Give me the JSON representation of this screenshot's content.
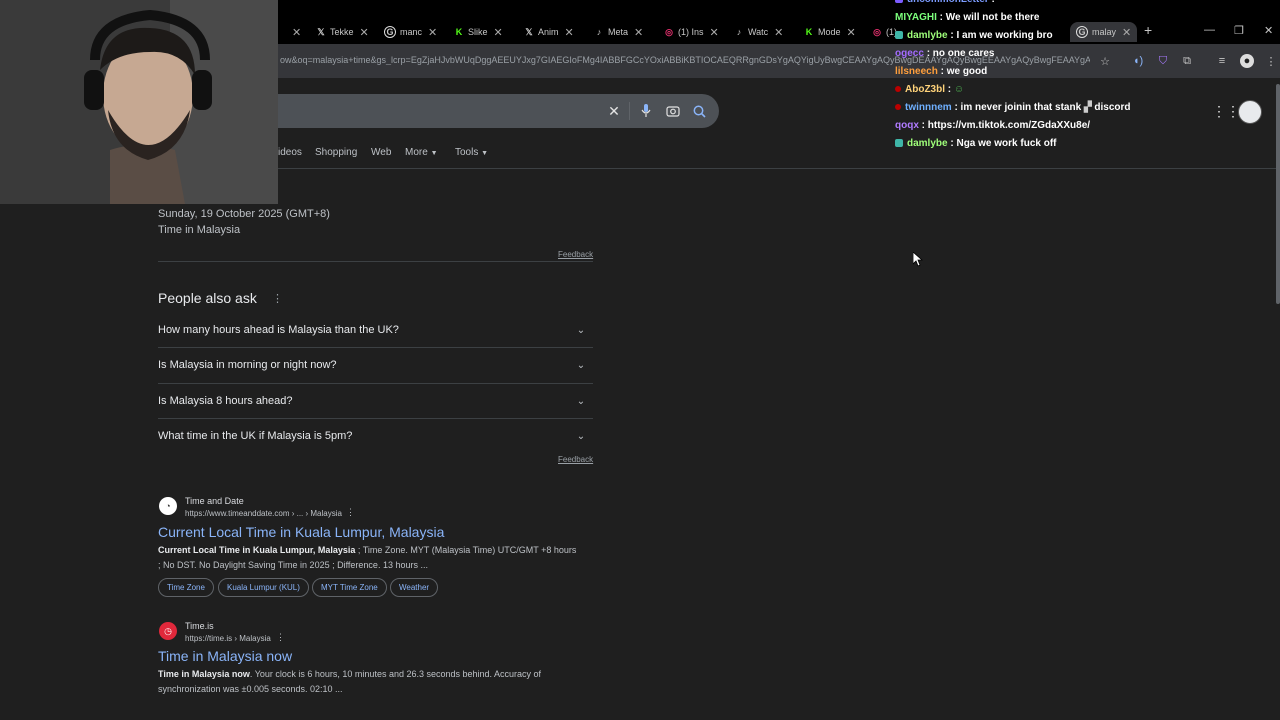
{
  "browser": {
    "tabs": [
      {
        "label": "",
        "icon": "close-icon"
      },
      {
        "label": "Tekke",
        "icon": "x-logo-icon"
      },
      {
        "label": "manc",
        "icon": "google-icon"
      },
      {
        "label": "Slike",
        "icon": "kick-icon"
      },
      {
        "label": "Anim",
        "icon": "x-logo-icon"
      },
      {
        "label": "Meta",
        "icon": "tiktok-icon"
      },
      {
        "label": "(1) Ins",
        "icon": "instagram-icon"
      },
      {
        "label": "Watc",
        "icon": "tiktok-icon"
      },
      {
        "label": "Mode",
        "icon": "kick-icon"
      },
      {
        "label": "(1)",
        "icon": "instagram-icon"
      },
      {
        "label": "malay",
        "icon": "google-icon"
      }
    ],
    "url": "ow&oq=malaysia+time&gs_lcrp=EgZjaHJvbWUqDggAEEUYJxg7GIAEGIoFMg4IABBFGCcYOxiABBiKBTIOCAEQRRgnGDsYgAQYigUyBwgCEAAYgAQyBwgDEAAYgAQyBwgEEAAYgAQyBwgFEAAYgAQyBwgGEAAYgAQyBwgFEAAYgAQyBwgB..."
  },
  "search": {
    "nav": [
      "ideos",
      "Shopping",
      "Web",
      "More",
      "Tools"
    ]
  },
  "time_result": {
    "date": "Sunday, 19 October 2025 (GMT+8)",
    "place": "Time in Malaysia",
    "feedback": "Feedback"
  },
  "paa": {
    "title": "People also ask",
    "questions": [
      "How many hours ahead is Malaysia than the UK?",
      "Is Malaysia in morning or night now?",
      "Is Malaysia 8 hours ahead?",
      "What time in the UK if Malaysia is 5pm?"
    ],
    "feedback": "Feedback"
  },
  "results": [
    {
      "site": "Time and Date",
      "url": "https://www.timeanddate.com › ... › Malaysia",
      "title": "Current Local Time in Kuala Lumpur, Malaysia",
      "snippet_line1_bold": "Current Local Time in Kuala Lumpur, Malaysia",
      "snippet_line1_rest": " ; Time Zone. MYT (Malaysia Time) UTC/GMT +8 hours",
      "snippet_line2": "; No DST. No Daylight Saving Time in 2025 ; Difference. 13 hours ...",
      "chips": [
        "Time Zone",
        "Kuala Lumpur (KUL)",
        "MYT Time Zone",
        "Weather"
      ]
    },
    {
      "site": "Time.is",
      "url": "https://time.is › Malaysia",
      "title": "Time in Malaysia now",
      "snippet_line1_bold": "Time in Malaysia now",
      "snippet_line1_rest": ". Your clock is 6 hours, 10 minutes and 26.3 seconds behind. Accuracy of",
      "snippet_line2": "synchronization was ±0.005 seconds. 02:10 ..."
    }
  ],
  "chat": [
    {
      "user": "uncommonLetter",
      "msg": ":",
      "color": "#7c9cff"
    },
    {
      "user": "MIYAGHI",
      "msg": ": We will not be there",
      "color": "#7cff7c"
    },
    {
      "user": "damlybe",
      "msg": ": I am we working bro",
      "color": "#9fff7a"
    },
    {
      "user": "ogecc",
      "msg": ": no one cares",
      "color": "#a36bff"
    },
    {
      "user": "lilsneech",
      "msg": ": we good",
      "color": "#ff9f3c"
    },
    {
      "user": "AboZ3bl",
      "msg": ":",
      "color": "#ffd37a"
    },
    {
      "user": "twinnnem",
      "msg": ": im never joinin that stank",
      "msg2": "discord",
      "color": "#6fb0ff"
    },
    {
      "user": "qoqx",
      "msg": ": https://vm.tiktok.com/ZGdaXXu8e/",
      "color": "#b07bff"
    },
    {
      "user": "damlybe",
      "msg": ": Nga we work fuck off",
      "color": "#9fff7a"
    }
  ]
}
